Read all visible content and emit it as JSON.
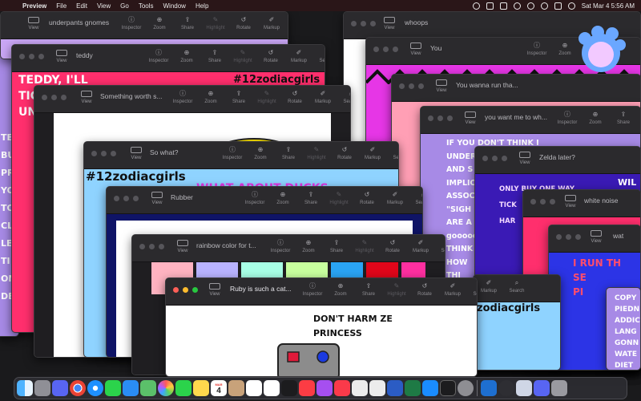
{
  "menubar": {
    "app_name": "Preview",
    "items": [
      "File",
      "Edit",
      "View",
      "Go",
      "Tools",
      "Window",
      "Help"
    ],
    "clock": "Sat Mar 4  5:56 AM"
  },
  "toolbar": {
    "view": "View",
    "inspector": "Inspector",
    "zoom": "Zoom",
    "share": "Share",
    "highlight": "Highlight",
    "rotate": "Rotate",
    "markup": "Markup",
    "search": "Search"
  },
  "windows": {
    "underpants": {
      "title": "underpants gnomes"
    },
    "teddy": {
      "title": "teddy",
      "text1": "TEDDY, I'LL",
      "text2": "TIC",
      "text3": "UN",
      "tag": "#12zodiacgirls"
    },
    "something": {
      "title": "Something worth s..."
    },
    "sowhat": {
      "title": "So what?",
      "tag": "#12zodiacgirls",
      "text": "WHAT ABOUT DUCKS"
    },
    "rubber": {
      "title": "Rubber"
    },
    "rainbow": {
      "title": "rainbow color for t..."
    },
    "ruby": {
      "title": "Ruby is such a cat...",
      "text1": "DON'T HARM ZE",
      "text2": "PRINCESS"
    },
    "whoops": {
      "title": "whoops"
    },
    "you": {
      "title": "You"
    },
    "wanna": {
      "title": "You wanna run tha..."
    },
    "wantme": {
      "title": "you want me to wh...",
      "lines": [
        "IF YOU DON'T THINK I",
        "UNDER",
        "AND S",
        "IMPLIC",
        "ASSOC",
        "\"SIGH",
        "ARE A",
        "gooooo",
        "THINK",
        "HOW",
        "THI"
      ]
    },
    "zelda": {
      "title": "Zelda later?",
      "text1": "ONLY BUY ONE WAY",
      "text2": "TICK",
      "text3": "HAR",
      "text4": "WIL"
    },
    "whitenoise": {
      "title": "white noise"
    },
    "wat": {
      "title": "wat",
      "text1": "I RUN TH",
      "text2": "SE",
      "text3": "PI"
    },
    "last": {
      "lines": [
        "COPY",
        "PIEDN",
        "ADDIC",
        "LANG",
        "GONN",
        "WATE",
        "DIET"
      ]
    },
    "zodiac_strip": {
      "tag": "zodiacgirls"
    },
    "leftedge": {
      "letters": [
        "TE",
        "BU",
        "PRO",
        "YOU",
        "TO",
        "CL",
        "LEV",
        "TI",
        "ON",
        "DEA"
      ]
    }
  },
  "dock": {
    "apps": [
      "finder-icon",
      "launchpad-icon",
      "discord-icon",
      "chrome-icon",
      "safari-icon",
      "messages-icon",
      "mail-icon",
      "maps-icon",
      "photos-icon",
      "facetime-icon",
      "notes-icon",
      "calendar-icon",
      "contacts-icon",
      "reminders-icon",
      "freeform-icon",
      "tv-icon",
      "music-icon",
      "podcasts-icon",
      "news-icon",
      "keynote-icon",
      "numbers-icon",
      "word-icon",
      "excel-icon",
      "app-store-icon",
      "terminal-icon",
      "system-settings-icon",
      "preview-icon",
      "vscode-icon",
      "vlc-icon",
      "obs-icon",
      "discord-2-icon",
      "trash-icon"
    ],
    "calendar_day": "4",
    "calendar_month": "MAR"
  },
  "colors": {
    "accent_magenta": "#e636e6",
    "lavender": "#c9a6f5",
    "pink": "#ff9fb5",
    "yellow": "#ffe600"
  }
}
